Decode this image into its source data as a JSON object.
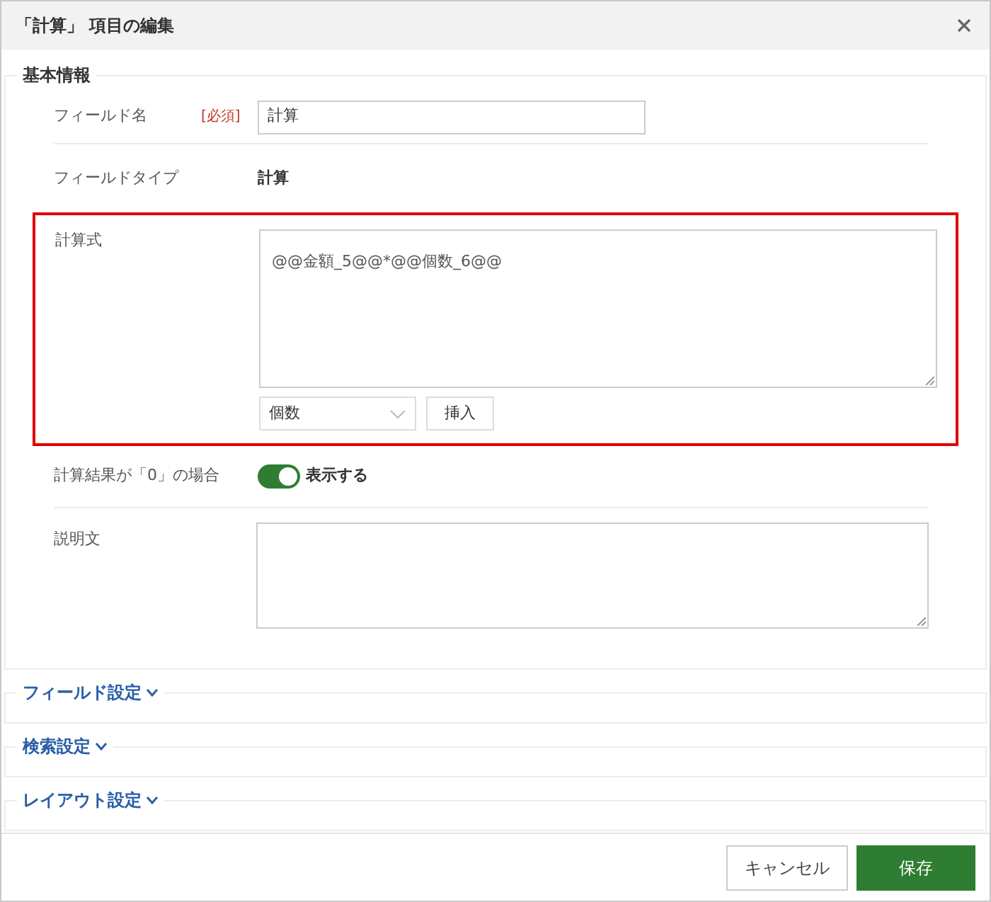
{
  "window": {
    "title": "「計算」 項目の編集"
  },
  "basic_section": {
    "title": "基本情報",
    "field_name": {
      "label": "フィールド名",
      "required": "[必須]",
      "value": "計算"
    },
    "field_type": {
      "label": "フィールドタイプ",
      "value": "計算"
    },
    "formula": {
      "label": "計算式",
      "value": "@@金額_5@@*@@個数_6@@",
      "select_value": "個数",
      "insert_button": "挿入",
      "highlighted": true
    },
    "zero_result": {
      "label": "計算結果が「0」の場合",
      "toggle_label": "表示する",
      "on": true
    },
    "description": {
      "label": "説明文"
    }
  },
  "collapsed_sections": [
    {
      "title": "フィールド設定",
      "expanded": false
    },
    {
      "title": "検索設定",
      "expanded": false
    },
    {
      "title": "レイアウト設定",
      "expanded": false
    }
  ],
  "buttons": {
    "cancel": "キャンセル",
    "save": "保存"
  }
}
